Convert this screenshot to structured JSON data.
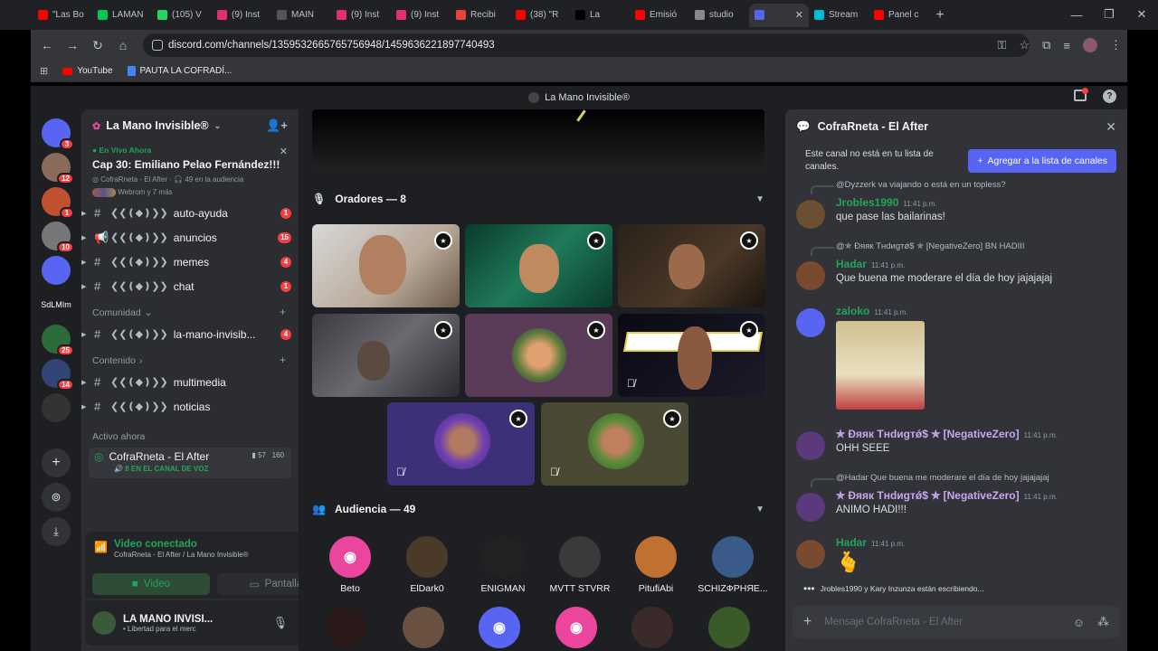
{
  "browser": {
    "tabs": [
      {
        "label": "\"Las Bo",
        "color": "#ff0000"
      },
      {
        "label": "LAMAN",
        "color": "#00c853"
      },
      {
        "label": "(105) V",
        "color": "#25d366"
      },
      {
        "label": "(9) Inst",
        "color": "#e1306c"
      },
      {
        "label": "MAIN",
        "color": "#555555"
      },
      {
        "label": "(9) Inst",
        "color": "#e1306c"
      },
      {
        "label": "(9) Inst",
        "color": "#e1306c"
      },
      {
        "label": "Recibi",
        "color": "#ea4335"
      },
      {
        "label": "(38) \"R",
        "color": "#ff0000"
      },
      {
        "label": "La",
        "color": "#000000"
      },
      {
        "label": "Emisió",
        "color": "#ff0000"
      },
      {
        "label": "studio",
        "color": "#888888"
      },
      {
        "label": "",
        "color": "#5865f2"
      },
      {
        "label": "Stream",
        "color": "#00bcd4"
      },
      {
        "label": "Panel c",
        "color": "#ff0000"
      }
    ],
    "url": "discord.com/channels/1359532665765756948/1459636221897740493",
    "bookmarks": [
      "YouTube",
      "PAUTA LA COFRADÍ..."
    ]
  },
  "app": {
    "title": "La Mano Invisible®"
  },
  "guilds": [
    {
      "label": "",
      "badge": "3",
      "color": "#5865f2"
    },
    {
      "label": "",
      "badge": "12",
      "color": "#8a6a5a"
    },
    {
      "label": "",
      "badge": "1",
      "color": "#c05030"
    },
    {
      "label": "",
      "badge": "10",
      "color": "#777777"
    },
    {
      "label": "",
      "badge": "",
      "color": "#5865f2"
    },
    {
      "label": "SdLMIm",
      "badge": "",
      "color": "#1e1f22"
    },
    {
      "label": "",
      "badge": "25",
      "color": "#2d6a3a"
    },
    {
      "label": "",
      "badge": "14",
      "color": "#334477"
    },
    {
      "label": "",
      "badge": "",
      "color": "#333333"
    }
  ],
  "server": {
    "name": "La Mano Invisible®",
    "live": {
      "tag": "En Vivo Ahora",
      "title": "Cap 30: Emiliano Pelao Fernández!!!",
      "channel": "CofraRneta - El After",
      "audience": "49 en la audiencia",
      "time": "Webrom y 7 más"
    },
    "channels": [
      {
        "name": "auto-ayuda",
        "count": "1",
        "sym": "#"
      },
      {
        "name": "anuncios",
        "count": "15",
        "sym": "📢"
      },
      {
        "name": "memes",
        "count": "4",
        "sym": "#"
      },
      {
        "name": "chat",
        "count": "1",
        "sym": "#"
      }
    ],
    "cat_comunidad": "Comunidad",
    "channels2": [
      {
        "name": "la-mano-invisib...",
        "count": "4",
        "sym": "#"
      }
    ],
    "cat_contenido": "Contenido",
    "channels3": [
      {
        "name": "multimedia",
        "count": "",
        "sym": "#"
      },
      {
        "name": "noticias",
        "count": "",
        "sym": "#"
      }
    ],
    "active_now": "Activo ahora",
    "voice_channel": {
      "name": "CofraRneta - El After",
      "users": "57",
      "bitrate": "160",
      "sub": "8 EN EL CANAL DE VOZ"
    }
  },
  "voice_panel": {
    "status": "Video conectado",
    "where": "CofraRneta - El After / La Mano Invisible®",
    "video": "Video",
    "screen": "Pantalla"
  },
  "user": {
    "name": "LA MANO INVISI...",
    "status": "• Libertad para el merc"
  },
  "stage": {
    "speakers_label": "Oradores — 8",
    "audience_label": "Audiencia — 49",
    "audience": [
      {
        "name": "Beto",
        "color": "#eb459e"
      },
      {
        "name": "ElDark0",
        "color": "#4a3a2a"
      },
      {
        "name": "ENIGMAN",
        "color": "#222222"
      },
      {
        "name": "MVTT STVRR",
        "color": "#3a3a3a"
      },
      {
        "name": "PitufiAbi",
        "color": "#c07030"
      },
      {
        "name": "SCHIZФPHЯE...",
        "color": "#3a5a8a"
      }
    ]
  },
  "chat": {
    "title": "CofraRneta - El After",
    "notice": "Este canal no está en tu lista de canales.",
    "add_button": "Agregar a la lista de canales",
    "messages": [
      {
        "reply": "@Dyzzerk va viajando o está en un topless?",
        "name": "Jrobles1990",
        "time": "11:41 p.m.",
        "text": "que pase las bailarinas!",
        "color": "#23a55a"
      },
      {
        "reply": "@✯ Đяяк Тнdиgтǿ$ ✯ [NegativeZero] BN HADIII",
        "name": "Hadar",
        "time": "11:41 p.m.",
        "text": "Que buena me moderare el día de hoy jajajajaj",
        "color": "#23a55a"
      },
      {
        "reply": "",
        "name": "zaloko",
        "time": "11:41 p.m.",
        "text": "",
        "color": "#23a55a"
      },
      {
        "reply": "",
        "name": "✯ Đяяк Тнdиgтǿ$ ✯ [NegativeZero]",
        "time": "11:41 p.m.",
        "text": "OHH SEEE",
        "color": "#c9a7f0"
      },
      {
        "reply": "@Hadar Que buena me moderare el día de hoy jajajajaj",
        "name": "✯ Đяяк Тнdиgтǿ$ ✯ [NegativeZero]",
        "time": "11:41 p.m.",
        "text": "ANIMO HADI!!!",
        "color": "#c9a7f0"
      },
      {
        "reply": "",
        "name": "Hadar",
        "time": "11:41 p.m.",
        "text": "🫰",
        "color": "#23a55a"
      }
    ],
    "typing": "Jrobles1990 y Kary Inzunza están escribiendo...",
    "placeholder": "Mensaje CofraRneta - El After"
  }
}
